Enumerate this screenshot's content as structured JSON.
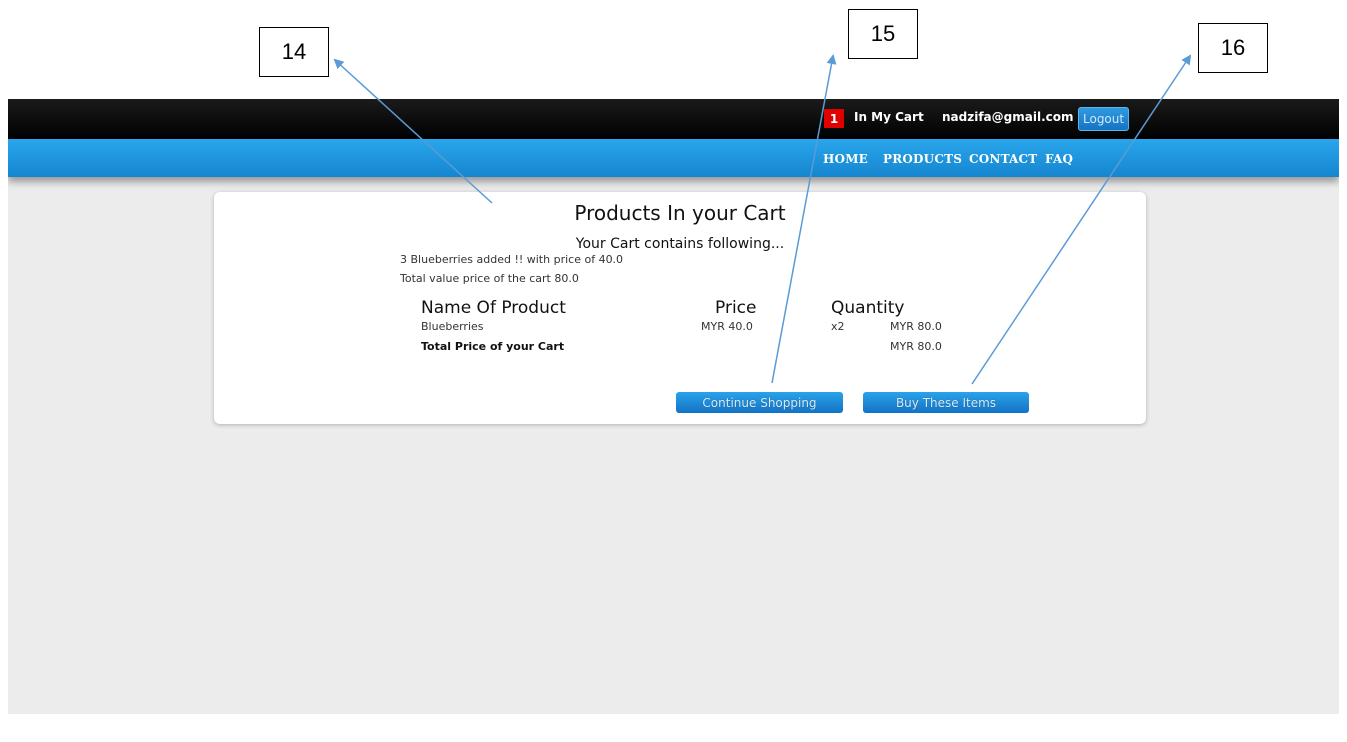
{
  "callouts": {
    "c14": "14",
    "c15": "15",
    "c16": "16"
  },
  "header": {
    "cart_count": "1",
    "cart_label": "In My Cart",
    "user_email": "nadzifa@gmail.com",
    "logout_label": "Logout"
  },
  "nav": {
    "home": "HOME",
    "products": "PRODUCTS",
    "contact": "CONTACT",
    "faq": "FAQ"
  },
  "cart": {
    "title": "Products In your Cart",
    "subtitle": "Your Cart contains following...",
    "added_message": "3 Blueberries added !! with price of 40.0",
    "total_message": "Total value price of the cart 80.0",
    "columns": {
      "name": "Name Of Product",
      "price": "Price",
      "quantity": "Quantity"
    },
    "items": [
      {
        "name": "Blueberries",
        "price": "MYR 40.0",
        "qty": "x2",
        "subtotal": "MYR 80.0"
      }
    ],
    "total_label": "Total Price of your Cart",
    "total_value": "MYR 80.0",
    "continue_label": "Continue Shopping",
    "buy_label": "Buy These Items"
  },
  "colors": {
    "accent": "#1a8fdd",
    "badge": "#e00000",
    "arrow": "#5b9bd5"
  }
}
